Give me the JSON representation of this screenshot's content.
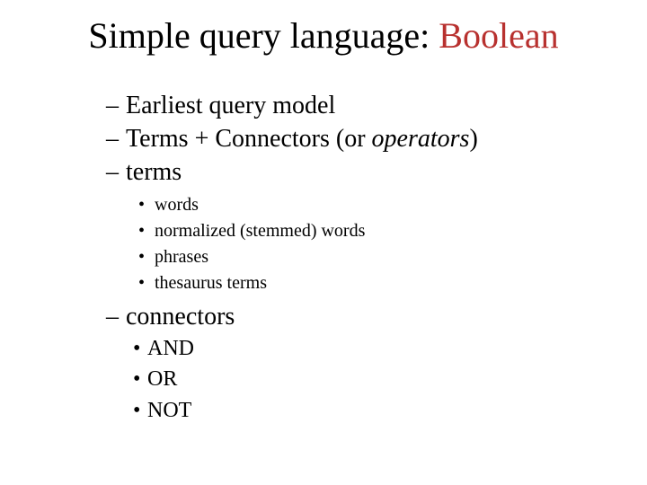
{
  "title": {
    "part1": "Simple query language: ",
    "part2": "Boolean"
  },
  "bullets": {
    "b1": "Earliest query model",
    "b2_pre": "Terms + Connectors (or ",
    "b2_em": "operators",
    "b2_post": ")",
    "b3": "terms",
    "b4": "connectors"
  },
  "terms_sub": {
    "s1": "words",
    "s2": "normalized (stemmed) words",
    "s3": "phrases",
    "s4": "thesaurus terms"
  },
  "conn_sub": {
    "s1": "AND",
    "s2": "OR",
    "s3": "NOT"
  },
  "glyphs": {
    "dash": "–",
    "dot": "•"
  }
}
